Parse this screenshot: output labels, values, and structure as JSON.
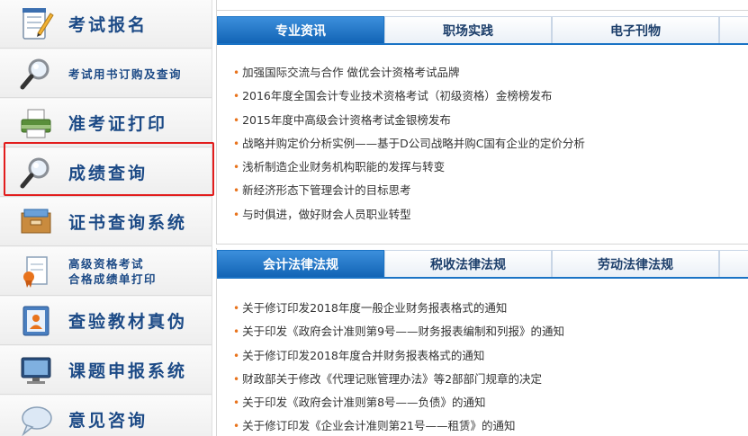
{
  "sidebar": {
    "items": [
      {
        "label": "考试报名",
        "icon": "notepad-pencil-icon"
      },
      {
        "label": "考试用书订购及查询",
        "icon": "magnifier-icon"
      },
      {
        "label": "准考证打印",
        "icon": "printer-icon"
      },
      {
        "label": "成绩查询",
        "icon": "magnifier-icon"
      },
      {
        "label": "证书查询系统",
        "icon": "archive-box-icon"
      },
      {
        "label_line1": "高级资格考试",
        "label_line2": "合格成绩单打印",
        "icon": "certificate-ribbon-icon"
      },
      {
        "label": "查验教材真伪",
        "icon": "id-book-icon"
      },
      {
        "label": "课题申报系统",
        "icon": "monitor-icon"
      },
      {
        "label": "意见咨询",
        "icon": "speech-bubble-icon"
      }
    ]
  },
  "news_panel": {
    "tabs": [
      "专业资讯",
      "职场实践",
      "电子刊物"
    ],
    "active_tab": 0,
    "items": [
      "加强国际交流与合作 做优会计资格考试品牌",
      "2016年度全国会计专业技术资格考试（初级资格）金榜榜发布",
      "2015年度中高级会计资格考试金银榜发布",
      "战略并购定价分析实例——基于D公司战略并购C国有企业的定价分析",
      "浅析制造企业财务机构职能的发挥与转变",
      "新经济形态下管理会计的目标思考",
      "与时俱进，做好财会人员职业转型"
    ]
  },
  "law_panel": {
    "tabs": [
      "会计法律法规",
      "税收法律法规",
      "劳动法律法规"
    ],
    "active_tab": 0,
    "items": [
      "关于修订印发2018年度一般企业财务报表格式的通知",
      "关于印发《政府会计准则第9号——财务报表编制和列报》的通知",
      "关于修订印发2018年度合并财务报表格式的通知",
      "财政部关于修改《代理记账管理办法》等2部部门规章的决定",
      "关于印发《政府会计准则第8号——负债》的通知",
      "关于修订印发《企业会计准则第21号——租赁》的通知"
    ]
  },
  "colors": {
    "sidebar_text": "#1c4a86",
    "tab_active": "#1a73c5",
    "highlight_border": "#e21d1d",
    "bullet": "#e8731c"
  }
}
